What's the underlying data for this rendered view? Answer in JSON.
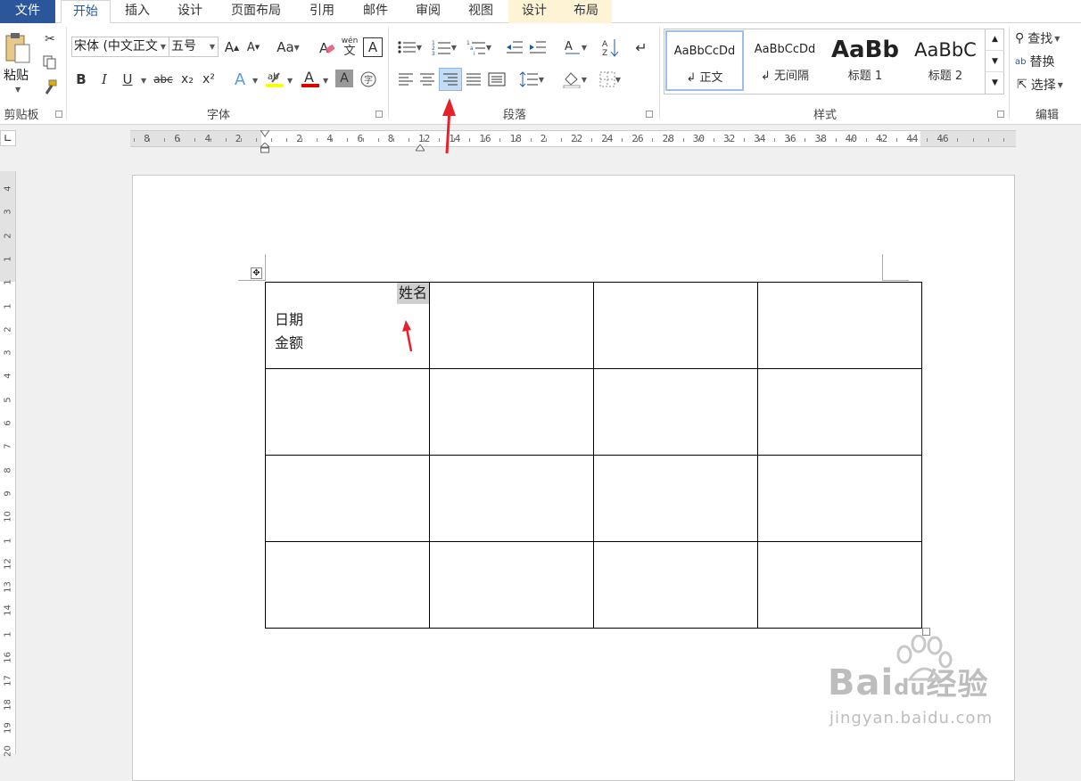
{
  "tabs": [
    {
      "label": "文件"
    },
    {
      "label": "开始"
    },
    {
      "label": "插入"
    },
    {
      "label": "设计"
    },
    {
      "label": "页面布局"
    },
    {
      "label": "引用"
    },
    {
      "label": "邮件"
    },
    {
      "label": "审阅"
    },
    {
      "label": "视图"
    },
    {
      "label": "设计"
    },
    {
      "label": "布局"
    }
  ],
  "clipboard": {
    "paste_label": "粘贴",
    "group_label": "剪贴板"
  },
  "font": {
    "family": "宋体 (中文正文",
    "size": "五号",
    "case_label": "Aa",
    "phonetic": "wén",
    "phonetic_char": "文",
    "bold": "B",
    "italic": "I",
    "underline": "U",
    "strike": "abc",
    "sub": "x₂",
    "sup": "x²",
    "group_label": "字体"
  },
  "paragraph": {
    "group_label": "段落"
  },
  "styles": {
    "group_label": "样式",
    "items": [
      {
        "sample": "AaBbCcDd",
        "name": "正文"
      },
      {
        "sample": "AaBbCcDd",
        "name": "无间隔"
      },
      {
        "sample": "AaBb",
        "name": "标题 1"
      },
      {
        "sample": "AaBbC",
        "name": "标题 2"
      }
    ]
  },
  "editing": {
    "find": "查找",
    "replace": "替换",
    "select": "选择",
    "group_label": "编辑"
  },
  "ruler": {
    "h_left": [
      "8",
      "6",
      "4",
      "2"
    ],
    "h_right": [
      "2",
      "4",
      "6",
      "8",
      "12",
      "14",
      "16",
      "18",
      "2",
      "22",
      "24",
      "26",
      "28",
      "30",
      "32",
      "34",
      "36",
      "38",
      "40",
      "42",
      "44",
      "46"
    ],
    "v": [
      "4",
      "3",
      "2",
      "1",
      "1",
      "1",
      "2",
      "3",
      "4",
      "5",
      "6",
      "7",
      "8",
      "9",
      "10",
      "1",
      "12",
      "13",
      "14",
      "1",
      "16",
      "17",
      "18",
      "19",
      "20"
    ]
  },
  "table": {
    "cell_name": "姓名",
    "cell_date": "日期",
    "cell_amount": "金额"
  },
  "watermark": {
    "brand": "Bai",
    "brand2": "du",
    "brand3": "经验",
    "url": "jingyan.baidu.com"
  },
  "colors": {
    "accent": "#2b579a",
    "arrow": "#e8202a",
    "highlight": "#ffff00",
    "font_color": "#e00000"
  }
}
